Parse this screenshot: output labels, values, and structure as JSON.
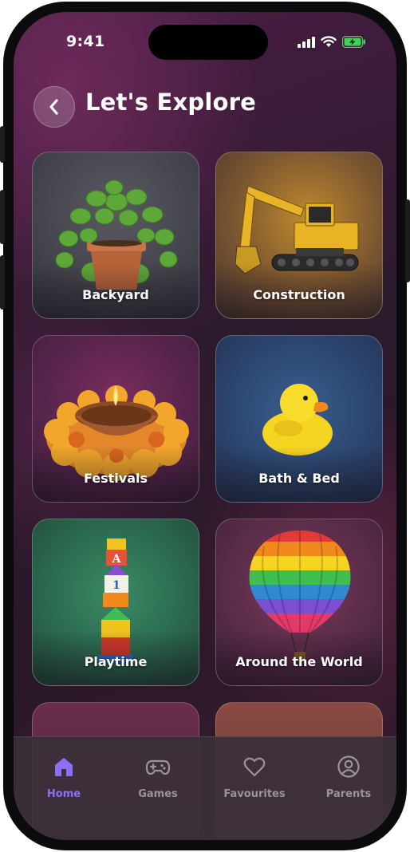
{
  "status_bar": {
    "time": "9:41",
    "icons": [
      "cellular-signal-icon",
      "wifi-icon",
      "battery-charging-icon"
    ],
    "battery_color": "#3fd35a"
  },
  "header": {
    "back_icon": "chevron-left-icon",
    "title": "Let's Explore"
  },
  "categories": [
    {
      "label": "Backyard",
      "image": "potted-plant"
    },
    {
      "label": "Construction",
      "image": "excavator"
    },
    {
      "label": "Festivals",
      "image": "diya-with-marigolds"
    },
    {
      "label": "Bath & Bed",
      "image": "rubber-duck"
    },
    {
      "label": "Playtime",
      "image": "stacked-toy-blocks"
    },
    {
      "label": "Around the World",
      "image": "hot-air-balloon"
    },
    {
      "label": "",
      "image": ""
    },
    {
      "label": "",
      "image": ""
    }
  ],
  "tabbar": {
    "items": [
      {
        "label": "Home",
        "icon": "home-icon",
        "active": true
      },
      {
        "label": "Games",
        "icon": "gamepad-icon",
        "active": false
      },
      {
        "label": "Favourites",
        "icon": "heart-icon",
        "active": false
      },
      {
        "label": "Parents",
        "icon": "user-circle-icon",
        "active": false
      }
    ],
    "active_color": "#8b6ff5",
    "inactive_color": "#9a929c"
  }
}
